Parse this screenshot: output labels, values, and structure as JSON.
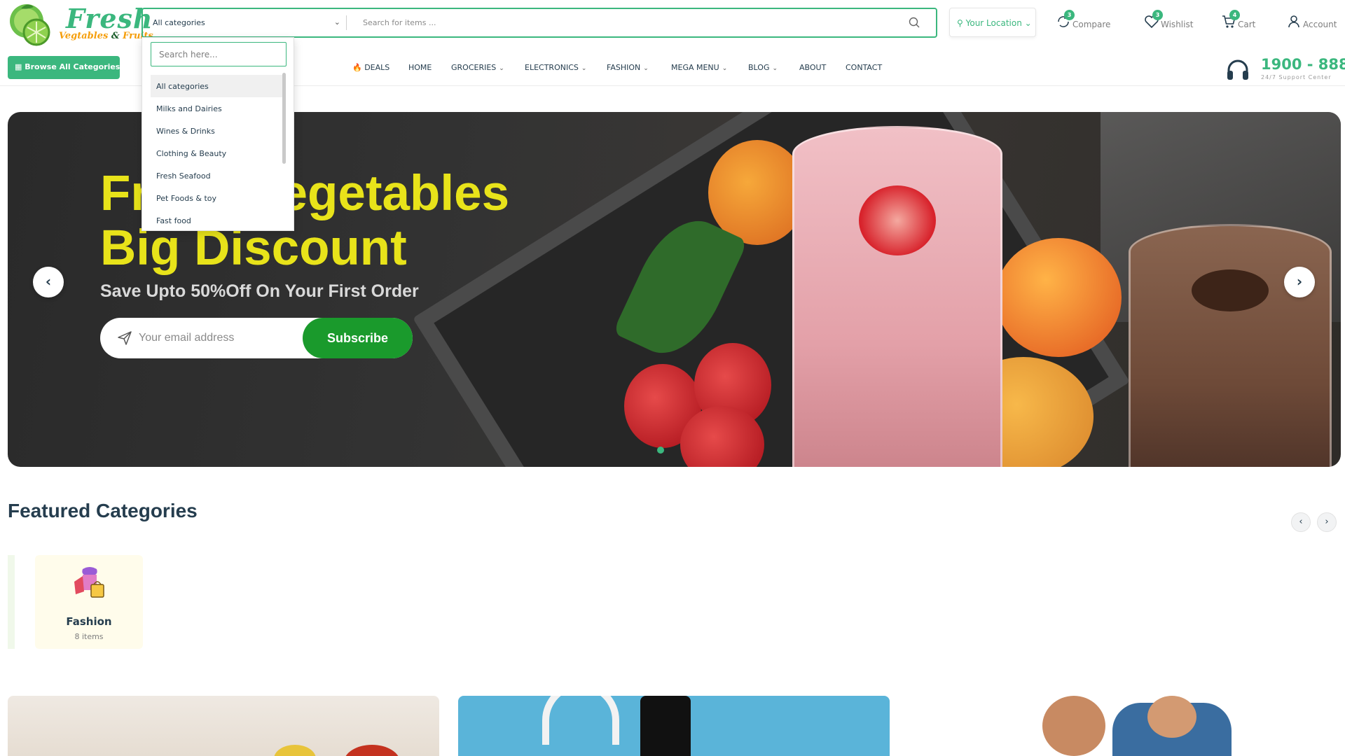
{
  "brand": {
    "name": "Fresh",
    "tagline_left": "Vegtables",
    "tagline_amp": "&",
    "tagline_right": "Fruits",
    "accent": "#3bb77e"
  },
  "search": {
    "category_selected": "All categories",
    "placeholder": "Search for items ..."
  },
  "location": {
    "label": "Your Location"
  },
  "header_actions": [
    {
      "label": "Compare",
      "count": "3",
      "icon": "compare-icon"
    },
    {
      "label": "Wishlist",
      "count": "3",
      "icon": "heart-icon"
    },
    {
      "label": "Cart",
      "count": "4",
      "icon": "cart-icon"
    },
    {
      "label": "Account",
      "icon": "user-icon"
    }
  ],
  "nav": {
    "browse_label": "Browse All Categories",
    "items": [
      "Deals",
      "Home",
      "Groceries",
      "Electronics",
      "Fashion",
      "Mega menu",
      "Blog",
      "About",
      "Contact"
    ]
  },
  "support": {
    "number": "1900 - 888",
    "subtitle": "24/7 Support Center"
  },
  "hero": {
    "title": "Fresh Vegetables\nBig Discount",
    "subtitle": "Save Upto 50%Off On Your First Order",
    "email_placeholder": "Your email address",
    "subscribe_label": "Subscribe"
  },
  "featured": {
    "title": "Featured Categories",
    "categories": [
      {
        "name": "Fashion",
        "count": "8 items"
      }
    ]
  },
  "dropdown": {
    "search_placeholder": "Search here...",
    "items": [
      "All categories",
      "Milks and Dairies",
      "Wines & Drinks",
      "Clothing & Beauty",
      "Fresh Seafood",
      "Pet Foods & toy",
      "Fast food"
    ]
  }
}
